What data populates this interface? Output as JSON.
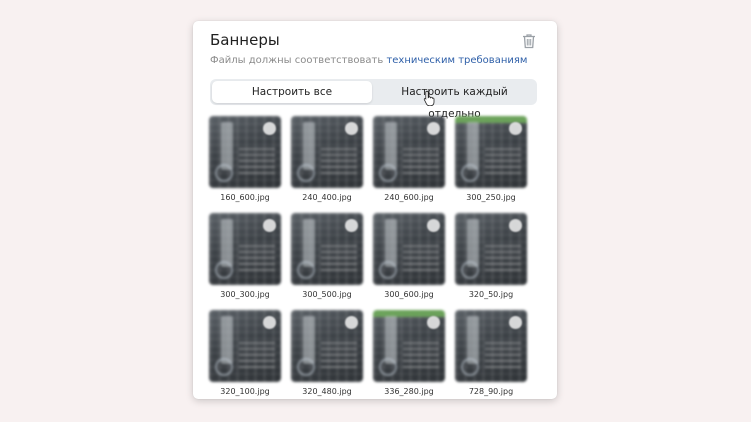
{
  "card": {
    "title": "Баннеры",
    "subtitle_prefix": "Файлы должны соответствовать ",
    "subtitle_link": "техническим требованиям",
    "delete_icon": "trash-icon"
  },
  "mode_switch": {
    "all_label": "Настроить все",
    "each_label": "Настроить каждый отдельно",
    "selected": "Настроить все"
  },
  "banners": [
    {
      "file": "160_600.jpg"
    },
    {
      "file": "240_400.jpg"
    },
    {
      "file": "240_600.jpg"
    },
    {
      "file": "300_250.jpg"
    },
    {
      "file": "300_300.jpg"
    },
    {
      "file": "300_500.jpg"
    },
    {
      "file": "300_600.jpg"
    },
    {
      "file": "320_50.jpg"
    },
    {
      "file": "320_100.jpg"
    },
    {
      "file": "320_480.jpg"
    },
    {
      "file": "336_280.jpg"
    },
    {
      "file": "728_90.jpg"
    }
  ],
  "colors": {
    "background": "#f8f1f1",
    "link": "#2e5fa8",
    "segment_bg": "#e9ecef"
  }
}
